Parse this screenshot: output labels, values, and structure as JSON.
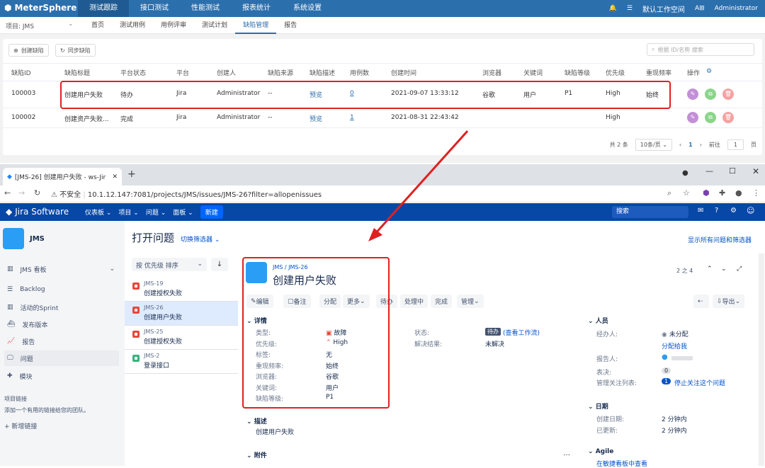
{
  "ms": {
    "logo": "MeterSphere",
    "nav": [
      "测试跟踪",
      "接口测试",
      "性能测试",
      "报表统计",
      "系统设置"
    ],
    "workspace": "默认工作空间",
    "lang": "A⊞",
    "user": "Administrator",
    "project": "项目: JMS",
    "subtabs": [
      "首页",
      "测试用例",
      "用例评审",
      "测试计划",
      "缺陷管理",
      "报告"
    ],
    "create_btn": "创建缺陷",
    "sync_btn": "同步缺陷",
    "search_placeholder": "根据 ID/名称 搜索",
    "columns": [
      "缺陷ID",
      "缺陷标题",
      "平台状态",
      "平台",
      "创建人",
      "缺陷来源",
      "缺陷描述",
      "用例数",
      "创建时间",
      "浏览器",
      "关键词",
      "缺陷等级",
      "优先级",
      "重现频率",
      "操作"
    ],
    "rows": [
      {
        "id": "100003",
        "title": "创建用户失败",
        "status": "待办",
        "platform": "Jira",
        "creator": "Administrator",
        "source": "--",
        "desc": "预览",
        "cases": "0",
        "created": "2021-09-07 13:33:12",
        "browser": "谷歌",
        "keyword": "用户",
        "level": "P1",
        "priority": "High",
        "freq": "始终"
      },
      {
        "id": "100002",
        "title": "创建资产失败...",
        "status": "完成",
        "platform": "Jira",
        "creator": "Administrator",
        "source": "--",
        "desc": "预览",
        "cases": "1",
        "created": "2021-08-31 22:43:42",
        "browser": "",
        "keyword": "",
        "level": "",
        "priority": "High",
        "freq": ""
      }
    ],
    "pager": {
      "total": "共 2 条",
      "size": "10条/页",
      "page": "1",
      "goto": "前往",
      "goto_val": "1",
      "unit": "页"
    }
  },
  "browser": {
    "tab_title": "[JMS-26] 创建用户失败 - ws-Jir",
    "insecure": "不安全",
    "url": "10.1.12.147:7081/projects/JMS/issues/JMS-26?filter=allopenissues"
  },
  "jira": {
    "logo": "Jira Software",
    "menu": [
      "仪表板",
      "项目",
      "问题",
      "面板"
    ],
    "create": "新建",
    "search": "搜索",
    "project": "JMS",
    "side": [
      "JMS 看板",
      "Backlog",
      "活动的Sprint",
      "发布版本",
      "报告",
      "问题",
      "模块"
    ],
    "proj_links": "项目链接",
    "proj_links_desc": "添加一个有用的链接给您的团队。",
    "add_link": "新增链接",
    "title": "打开问题",
    "switch_filter": "切换筛选器",
    "show_all": "显示所有问题和筛选器",
    "sort": "按 优先级 排序",
    "issues": [
      {
        "key": "JMS-19",
        "summary": "创建授权失败",
        "color": "#e5493a"
      },
      {
        "key": "JMS-26",
        "summary": "创建用户失败",
        "color": "#e5493a"
      },
      {
        "key": "JMS-25",
        "summary": "创建授权失败",
        "color": "#e5493a"
      },
      {
        "key": "JMS-2",
        "summary": "登录接口",
        "color": "#36b37e"
      }
    ],
    "bc_proj": "JMS",
    "bc_key": "JMS-26",
    "issue_title": "创建用户失败",
    "nav_count": "2 之 4",
    "buttons": [
      "编辑",
      "备注",
      "分配",
      "更多",
      "待办",
      "处理中",
      "完成",
      "管理"
    ],
    "export": "导出",
    "details": "详情",
    "fields": [
      {
        "l": "类型:",
        "v": "故障"
      },
      {
        "l": "优先级:",
        "v": "High"
      },
      {
        "l": "标签:",
        "v": "无"
      },
      {
        "l": "重现频率:",
        "v": "始终"
      },
      {
        "l": "浏览器:",
        "v": "谷歌"
      },
      {
        "l": "关键词:",
        "v": "用户"
      },
      {
        "l": "缺陷等级:",
        "v": "P1"
      }
    ],
    "status_l": "状态:",
    "status_v": "待办",
    "workflow": "(查看工作流)",
    "resolution_l": "解决结果:",
    "resolution_v": "未解决",
    "desc_h": "描述",
    "desc_v": "创建用户失败",
    "attach_h": "附件",
    "people_h": "人员",
    "assignee_l": "经办人:",
    "assignee_v": "未分配",
    "assign_me": "分配给我",
    "reporter_l": "报告人:",
    "votes_l": "表决:",
    "votes_v": "0",
    "watchers_l": "管理关注列表:",
    "watchers_v": "1",
    "watch_stop": "停止关注这个问题",
    "dates_h": "日期",
    "created_l": "创建日期:",
    "created_v": "2 分钟内",
    "updated_l": "已更新:",
    "updated_v": "2 分钟内",
    "agile_h": "Agile",
    "agile_link": "在敏捷看板中查看"
  }
}
